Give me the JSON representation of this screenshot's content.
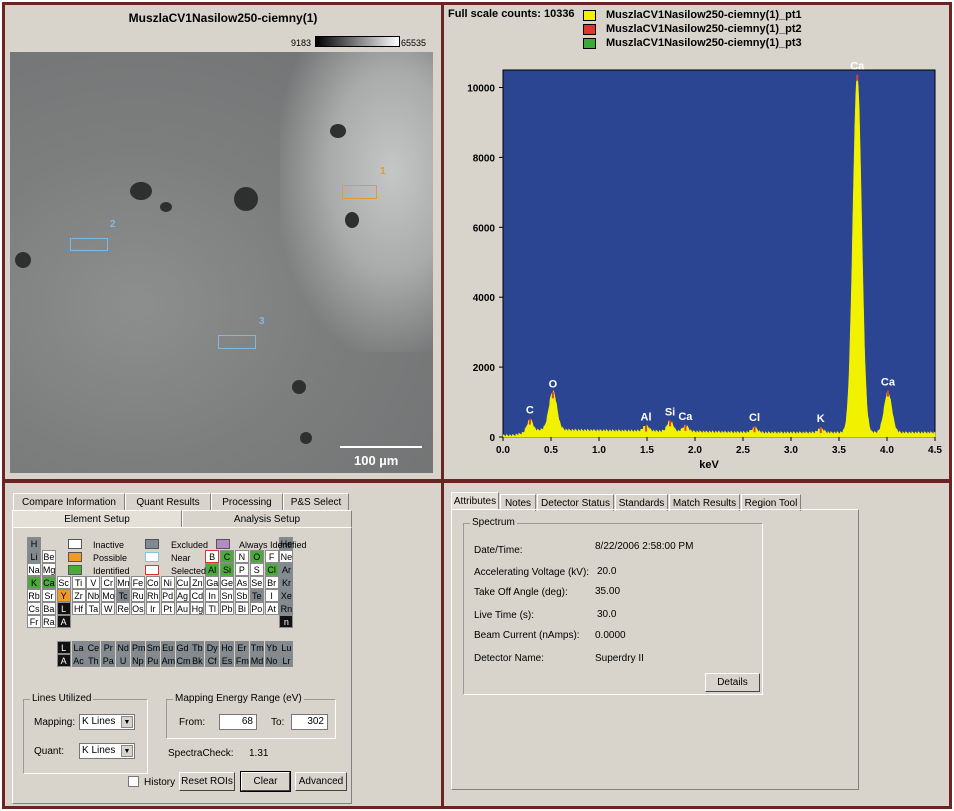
{
  "image": {
    "title": "MuszlaCV1Nasilow250-ciemny(1)",
    "gray_min": "9183",
    "gray_max": "65535",
    "scale_bar": "100 µm",
    "roi_labels": [
      "1",
      "2",
      "3"
    ]
  },
  "spectrum": {
    "full_scale_label": "Full scale counts: 10336",
    "legend": [
      {
        "name": "MuszlaCV1Nasilow250-ciemny(1)_pt1",
        "color": "#f2f200"
      },
      {
        "name": "MuszlaCV1Nasilow250-ciemny(1)_pt2",
        "color": "#d8392b"
      },
      {
        "name": "MuszlaCV1Nasilow250-ciemny(1)_pt3",
        "color": "#3ea83a"
      }
    ]
  },
  "chart_data": {
    "type": "area",
    "xlabel": "keV",
    "ylabel": "",
    "xlim": [
      0,
      4.5
    ],
    "ylim": [
      0,
      10500
    ],
    "x_ticks": [
      0.0,
      0.5,
      1.0,
      1.5,
      2.0,
      2.5,
      3.0,
      3.5,
      4.0,
      4.5
    ],
    "y_ticks": [
      0,
      2000,
      4000,
      6000,
      8000,
      10000
    ],
    "background_color": "#2b4593",
    "fill_color": "#f2f200",
    "peaks": [
      {
        "label": "C",
        "x": 0.28,
        "y": 500
      },
      {
        "label": "O",
        "x": 0.52,
        "y": 1250
      },
      {
        "label": "Al",
        "x": 1.49,
        "y": 300
      },
      {
        "label": "Si",
        "x": 1.74,
        "y": 450
      },
      {
        "label": "Ca",
        "x": 1.9,
        "y": 320
      },
      {
        "label": "Cl",
        "x": 2.62,
        "y": 280
      },
      {
        "label": "K",
        "x": 3.31,
        "y": 260
      },
      {
        "label": "Ca",
        "x": 3.69,
        "y": 10336
      },
      {
        "label": "Ca",
        "x": 4.01,
        "y": 1300
      }
    ]
  },
  "element_panel": {
    "tabs_row1": [
      "Compare Information",
      "Quant Results",
      "Processing",
      "P&S Select"
    ],
    "tabs_row2": [
      "Element Setup",
      "Analysis Setup"
    ],
    "legend": {
      "inactive": "Inactive",
      "possible": "Possible",
      "identified": "Identified",
      "excluded": "Excluded",
      "near": "Near",
      "selected": "Selected",
      "always_identified": "Always Identified"
    },
    "lines_utilized_title": "Lines Utilized",
    "mapping_label": "Mapping:",
    "mapping_value": "K Lines",
    "quant_label": "Quant:",
    "quant_value": "K Lines",
    "energy_range_title": "Mapping Energy Range (eV)",
    "from_label": "From:",
    "from_value": "68",
    "to_label": "To:",
    "to_value": "302",
    "spectracheck_label": "SpectraCheck:",
    "spectracheck_value": "1.31",
    "history_label": "History",
    "reset_rois": "Reset ROIs",
    "clear": "Clear",
    "advanced": "Advanced"
  },
  "attributes_panel": {
    "tabs": [
      "Attributes",
      "Notes",
      "Detector Status",
      "Standards",
      "Match Results",
      "Region Tool"
    ],
    "group_title": "Spectrum",
    "rows": [
      {
        "label": "Date/Time:",
        "value": "8/22/2006 2:58:00 PM"
      },
      {
        "label": "Accelerating Voltage (kV):",
        "value": "20.0"
      },
      {
        "label": "Take Off Angle (deg):",
        "value": "35.00"
      },
      {
        "label": "Live Time (s):",
        "value": "30.0"
      },
      {
        "label": "Beam Current (nAmps):",
        "value": "0.0000"
      },
      {
        "label": "Detector Name:",
        "value": "Superdry II"
      }
    ],
    "details_button": "Details"
  }
}
